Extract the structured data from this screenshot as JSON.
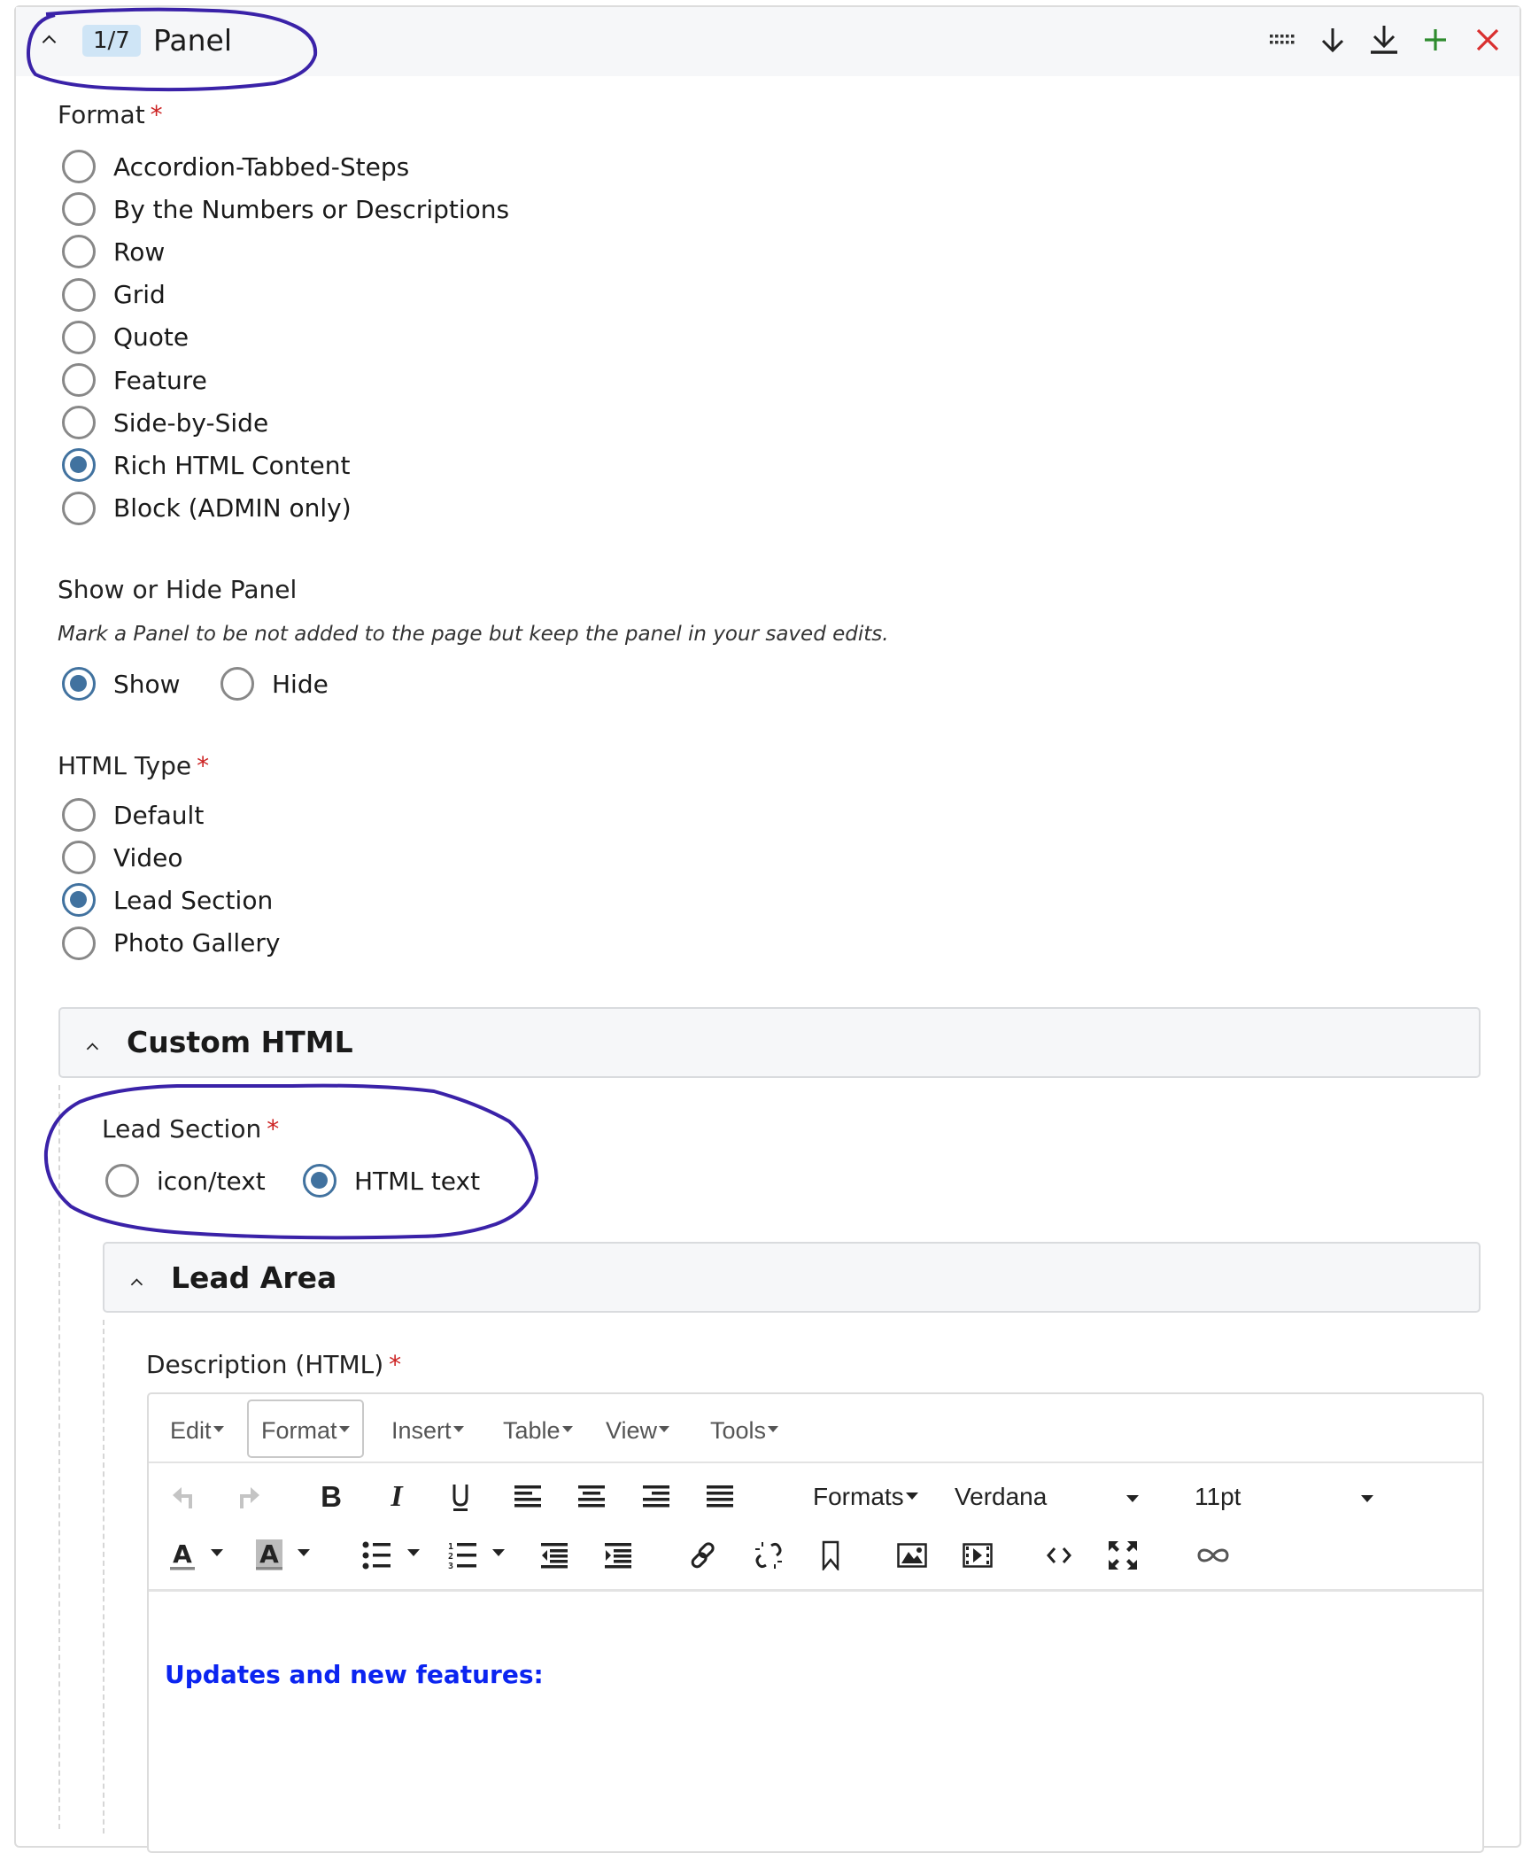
{
  "panel": {
    "counter": "1/7",
    "title": "Panel",
    "actions": [
      {
        "name": "drag-handle-icon",
        "glyph": "⠿"
      },
      {
        "name": "move-down-icon",
        "glyph": "↓"
      },
      {
        "name": "move-to-bottom-icon",
        "glyph": "⤓"
      },
      {
        "name": "add-icon",
        "glyph": "+"
      },
      {
        "name": "remove-icon",
        "glyph": "×"
      }
    ]
  },
  "format": {
    "label": "Format",
    "required": "*",
    "options": [
      "Accordion-Tabbed-Steps",
      "By the Numbers or Descriptions",
      "Row",
      "Grid",
      "Quote",
      "Feature",
      "Side-by-Side",
      "Rich HTML Content",
      "Block (ADMIN only)"
    ],
    "selected": "Rich HTML Content"
  },
  "visibility": {
    "label": "Show or Hide Panel",
    "hint": "Mark a Panel to be not added to the page but keep the panel in your saved edits.",
    "options": [
      "Show",
      "Hide"
    ],
    "selected": "Show"
  },
  "html_type": {
    "label": "HTML Type",
    "required": "*",
    "options": [
      "Default",
      "Video",
      "Lead Section",
      "Photo Gallery"
    ],
    "selected": "Lead Section"
  },
  "custom_html": {
    "title": "Custom HTML",
    "lead_section": {
      "label": "Lead Section",
      "required": "*",
      "options": [
        "icon/text",
        "HTML text"
      ],
      "selected": "HTML text"
    },
    "lead_area": {
      "title": "Lead Area",
      "description_label": "Description (HTML)",
      "required": "*"
    }
  },
  "editor": {
    "menus": [
      "Edit",
      "Format",
      "Insert",
      "Table",
      "View",
      "Tools"
    ],
    "active_menu": "Format",
    "formats_label": "Formats",
    "font_family": "Verdana",
    "font_size": "11pt",
    "toolbar_row1": [
      "undo-icon",
      "redo-icon",
      "bold-icon",
      "italic-icon",
      "underline-icon",
      "align-left-icon",
      "align-center-icon",
      "align-right-icon",
      "align-justify-icon"
    ],
    "toolbar_row2": [
      "text-color-icon",
      "background-color-icon",
      "bullet-list-icon",
      "numbered-list-icon",
      "outdent-icon",
      "indent-icon",
      "link-icon",
      "unlink-icon",
      "bookmark-icon",
      "image-icon",
      "media-icon",
      "source-code-icon",
      "fullscreen-icon",
      "infinity-icon"
    ],
    "content": "Updates and new features:",
    "content_color": "#0b24f0"
  },
  "colors": {
    "accent": "#41729f",
    "required": "#cc2222",
    "add": "#2e8b2e",
    "remove": "#d93030",
    "annotation": "#3a22a8"
  }
}
